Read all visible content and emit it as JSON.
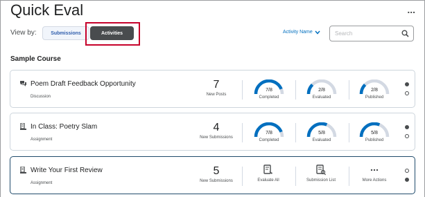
{
  "page": {
    "title": "Quick Eval",
    "more_label": "...",
    "view_by_label": "View by:",
    "view_tabs": [
      "Submissions",
      "Activities"
    ],
    "selected_view": "Activities",
    "sort_label": "Activity Name",
    "search_placeholder": "Search",
    "course_name": "Sample Course"
  },
  "colors": {
    "accent": "#006fbf",
    "selected_tab_bg": "#494c4e",
    "highlight": "#c6002a",
    "gauge_fill": "#006fbf",
    "gauge_track": "#d3d9e3"
  },
  "activities": [
    {
      "icon": "discussion-icon",
      "title": "Poem Draft Feedback Opportunity",
      "type": "Discussion",
      "count": "7",
      "count_label": "New Posts",
      "gauges": [
        {
          "value": "7/8",
          "fraction": 0.875,
          "label": "Completed"
        },
        {
          "value": "2/8",
          "fraction": 0.25,
          "label": "Evaluated"
        },
        {
          "value": "2/8",
          "fraction": 0.25,
          "label": "Published"
        }
      ],
      "page_dot": 1
    },
    {
      "icon": "assignment-icon",
      "title": "In Class: Poetry Slam",
      "type": "Assignment",
      "count": "4",
      "count_label": "New Submissions",
      "gauges": [
        {
          "value": "7/8",
          "fraction": 0.875,
          "label": "Completed"
        },
        {
          "value": "5/8",
          "fraction": 0.625,
          "label": "Evaluated"
        },
        {
          "value": "5/8",
          "fraction": 0.625,
          "label": "Published"
        }
      ],
      "page_dot": 1
    },
    {
      "icon": "assignment-icon",
      "title": "Write Your First Review",
      "type": "Assignment",
      "count": "5",
      "count_label": "New Submissions",
      "actions": [
        {
          "icon": "evaluate-all-icon",
          "label": "Evaluate All"
        },
        {
          "icon": "submission-list-icon",
          "label": "Submission List"
        },
        {
          "icon": "more-actions-icon",
          "label": "More Actions"
        }
      ],
      "page_dot": 2
    }
  ]
}
